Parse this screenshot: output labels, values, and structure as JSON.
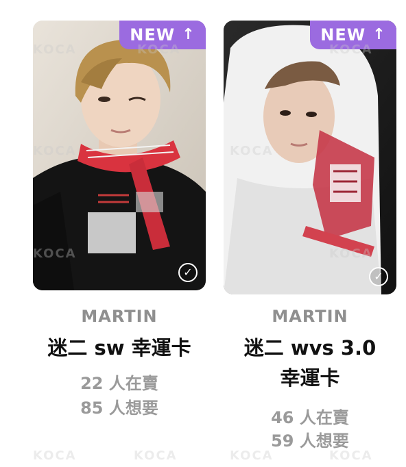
{
  "cards": [
    {
      "badge": "NEW",
      "badge_icon": "arrow-up-icon",
      "artist": "MARTIN",
      "title_line1": "迷二 sw 幸運卡",
      "title_line2": "",
      "selling": "22 人在賣",
      "wanting": "85 人想要",
      "check_icon": "check-circle-icon"
    },
    {
      "badge": "NEW",
      "badge_icon": "arrow-up-icon",
      "artist": "MARTIN",
      "title_line1": "迷二 wvs 3.0",
      "title_line2": "幸運卡",
      "selling": "46 人在賣",
      "wanting": "59 人想要",
      "check_icon": "check-circle-icon"
    }
  ],
  "colors": {
    "badge_bg": "#9b6be0",
    "artist_text": "#8f8f8f",
    "title_text": "#111111",
    "stat_text": "#9a9a9a"
  },
  "watermark": "KOCA"
}
